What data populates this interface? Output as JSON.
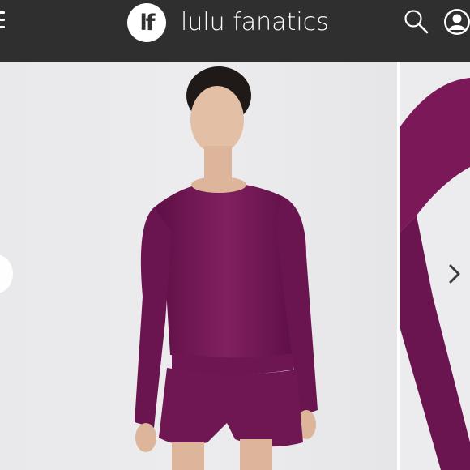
{
  "header": {
    "logo_text": "lf",
    "brand_name": "lulu fanatics",
    "icons": [
      "menu-icon",
      "search-icon",
      "user-avatar-icon"
    ]
  },
  "carousel": {
    "main_image": "woman-wearing-purple-long-sleeve-top-and-shorts",
    "next_image": "purple-sleeve-closeup",
    "controls": [
      "previous-image-button",
      "next-image-button"
    ]
  },
  "colors": {
    "header_bg": "#2f2f2f",
    "garment_purple": "#7a1858",
    "photo_bg": "#ececee"
  }
}
